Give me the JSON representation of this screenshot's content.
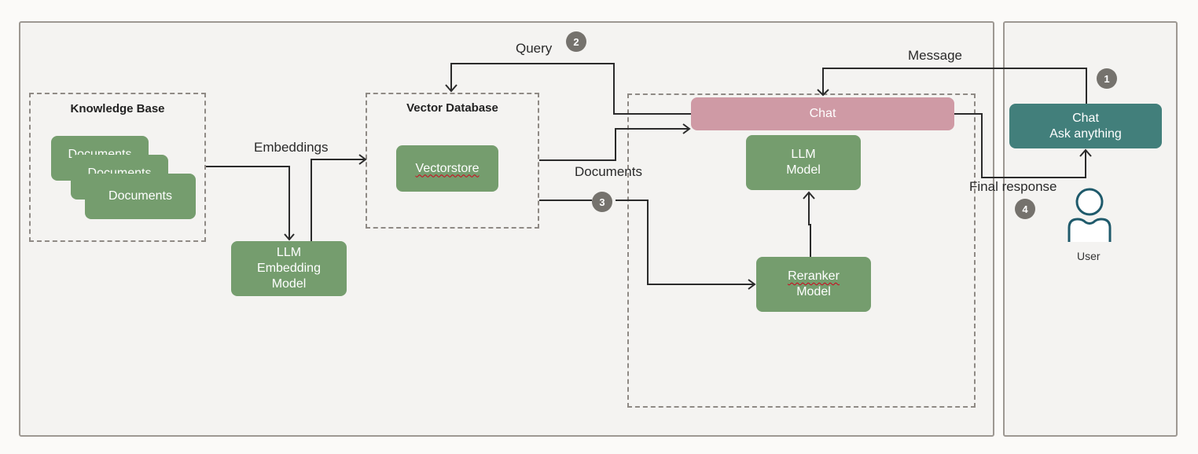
{
  "groups": {
    "knowledge_base": {
      "title": "Knowledge Base",
      "documents": [
        "Documents",
        "Documents",
        "Documents"
      ]
    },
    "vector_database": {
      "title": "Vector Database",
      "store": "Vectorstore"
    }
  },
  "nodes": {
    "embedding_model": "LLM\nEmbedding\nModel",
    "chat_backend": "Chat",
    "llm_model": "LLM\nModel",
    "reranker_model": "Reranker\nModel",
    "chat_frontend": "Chat\nAsk anything",
    "user": "User"
  },
  "edges": {
    "embeddings": "Embeddings",
    "query": "Query",
    "documents": "Documents",
    "message": "Message",
    "final_response": "Final response"
  },
  "steps": [
    "1",
    "2",
    "3",
    "4"
  ],
  "colors": {
    "model_green": "#759d6e",
    "chat_pink": "#cf9aa5",
    "frontend_teal": "#427f7b",
    "badge_gray": "#75726d",
    "user_icon": "#1f5a6b"
  }
}
